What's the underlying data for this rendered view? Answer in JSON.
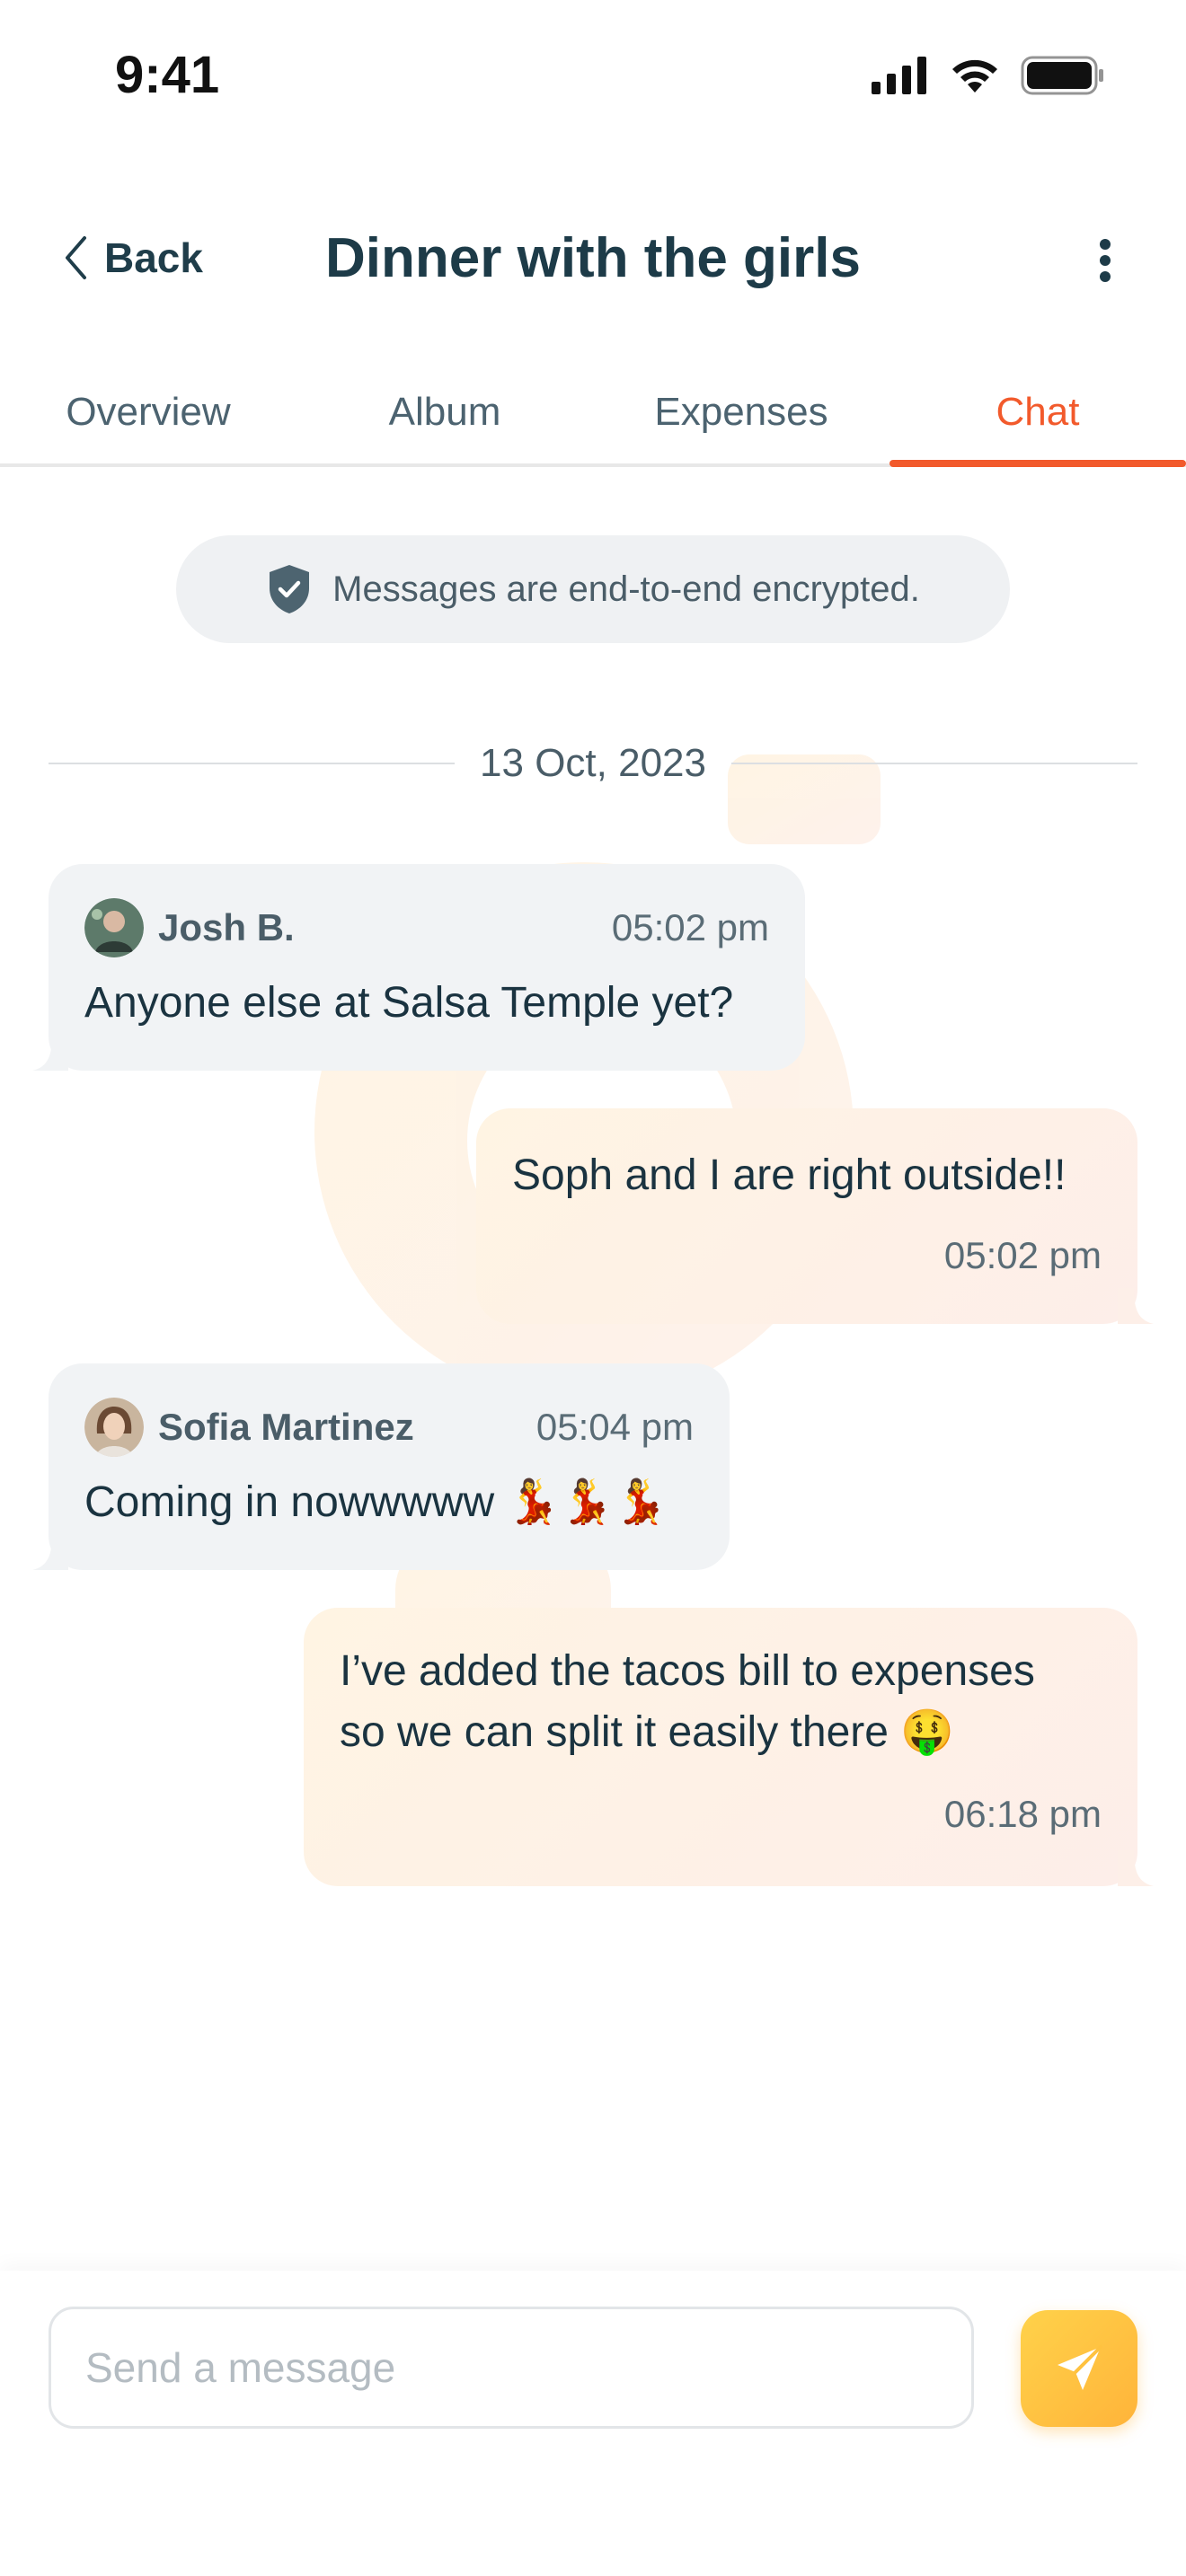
{
  "status_bar": {
    "time": "9:41"
  },
  "header": {
    "back_label": "Back",
    "title": "Dinner with the girls"
  },
  "tabs": [
    {
      "label": "Overview",
      "active": false
    },
    {
      "label": "Album",
      "active": false
    },
    {
      "label": "Expenses",
      "active": false
    },
    {
      "label": "Chat",
      "active": true
    }
  ],
  "encryption_notice": "Messages are end-to-end encrypted.",
  "date_divider": "13 Oct, 2023",
  "messages": [
    {
      "direction": "incoming",
      "sender": "Josh B.",
      "time": "05:02 pm",
      "text": "Anyone else at Salsa Temple yet?"
    },
    {
      "direction": "outgoing",
      "time": "05:02 pm",
      "text": "Soph and I are right outside!!"
    },
    {
      "direction": "incoming",
      "sender": "Sofia Martinez",
      "time": "05:04 pm",
      "text": "Coming in nowwwww 💃💃💃"
    },
    {
      "direction": "outgoing",
      "time": "06:18 pm",
      "text_line1": "I’ve added the tacos bill to expenses",
      "text_line2": "so we can split it easily there 🤑"
    }
  ],
  "composer": {
    "placeholder": "Send a message"
  },
  "colors": {
    "accent": "#f25a2c",
    "send_button": "#ffc23f",
    "incoming_bubble": "#f1f3f5",
    "outgoing_bubble": "#fff1e6",
    "text_primary": "#1d3b48"
  },
  "icons": {
    "back": "chevron-left-icon",
    "more": "vertical-dots-icon",
    "encryption": "shield-check-icon",
    "send": "paper-plane-icon",
    "signal": "signal-icon",
    "wifi": "wifi-icon",
    "battery": "battery-icon"
  }
}
